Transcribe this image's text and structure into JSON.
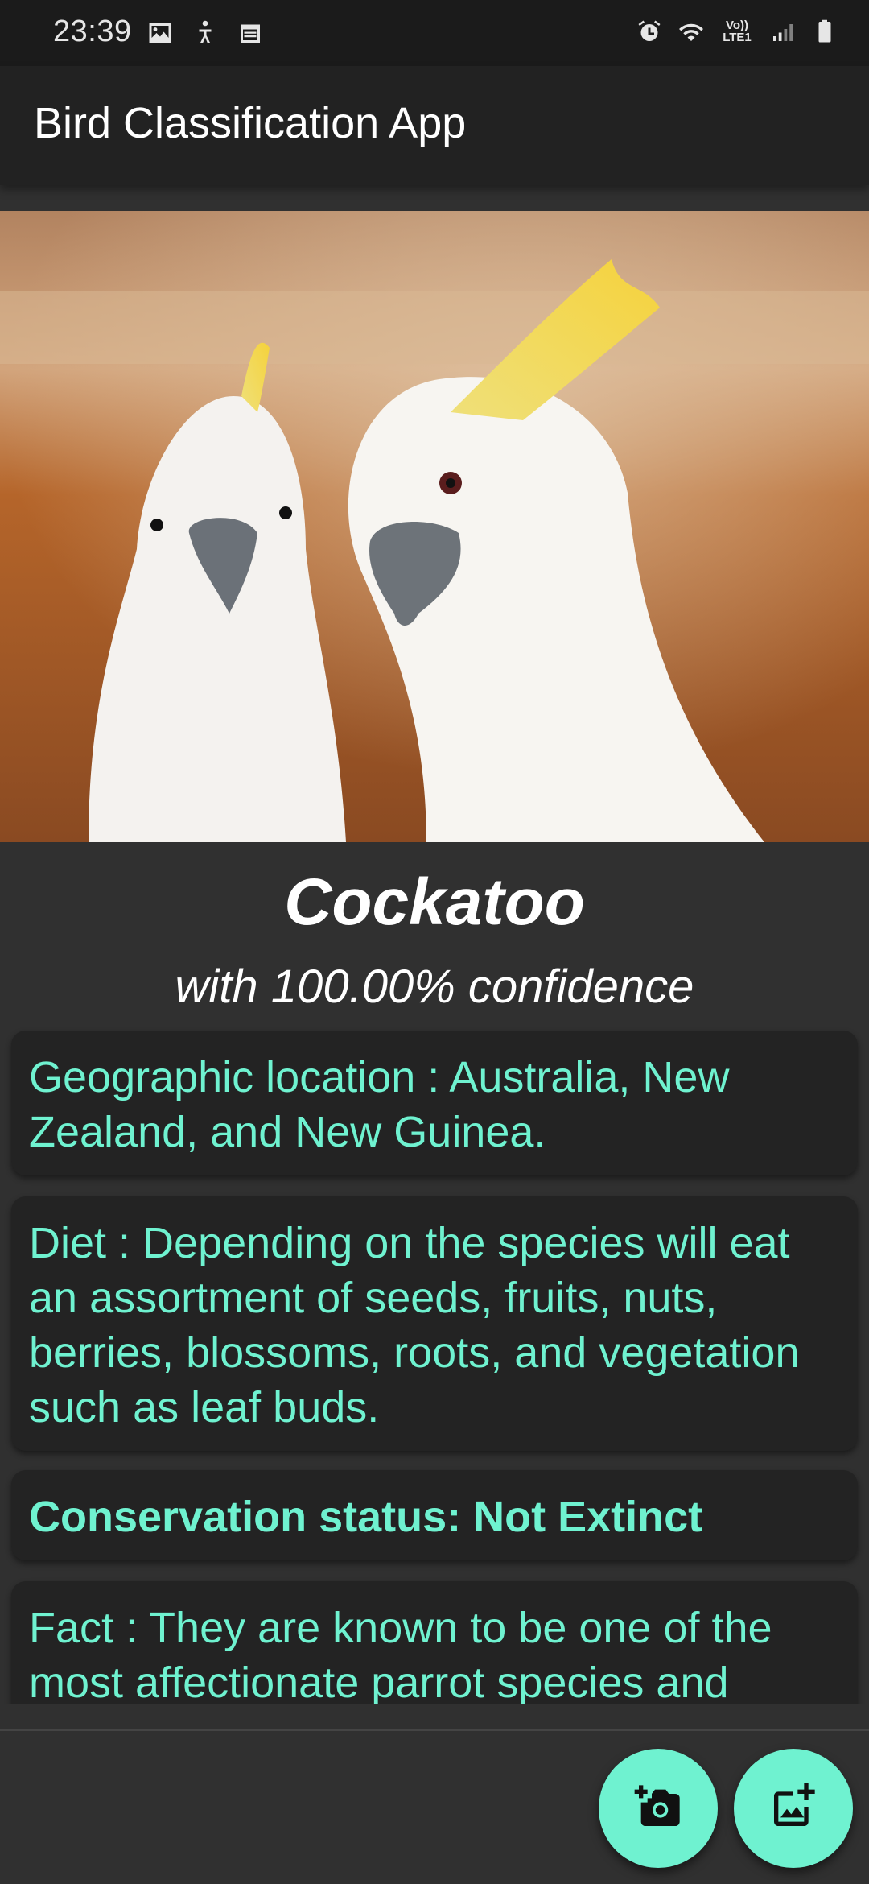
{
  "status_bar": {
    "time": "23:39",
    "left_icons": [
      "image-icon",
      "accessibility-icon",
      "calendar-icon"
    ],
    "right_icons": [
      "alarm-icon",
      "wifi-icon",
      "volte-icon",
      "signal-icon",
      "battery-icon"
    ],
    "volte_label_top": "Vo))",
    "volte_label_bottom": "LTE1"
  },
  "appbar": {
    "title": "Bird Classification App"
  },
  "result": {
    "bird_name": "Cockatoo",
    "confidence": "with 100.00% confidence"
  },
  "cards": {
    "location": "Geographic location : Australia, New Zealand, and New Guinea.",
    "diet": "Diet : Depending on the species will eat an assortment of seeds, fruits, nuts, berries, blossoms, roots, and vegetation such as leaf buds.",
    "conservation": "Conservation status: Not Extinct",
    "fact": "Fact : They are known to be one of the most affectionate parrot species and"
  },
  "fabs": {
    "camera_icon": "add-photo-camera-icon",
    "gallery_icon": "add-photo-gallery-icon"
  },
  "colors": {
    "accent": "#6ff2d0",
    "background": "#303030",
    "appbar": "#222222",
    "card": "#232323"
  }
}
